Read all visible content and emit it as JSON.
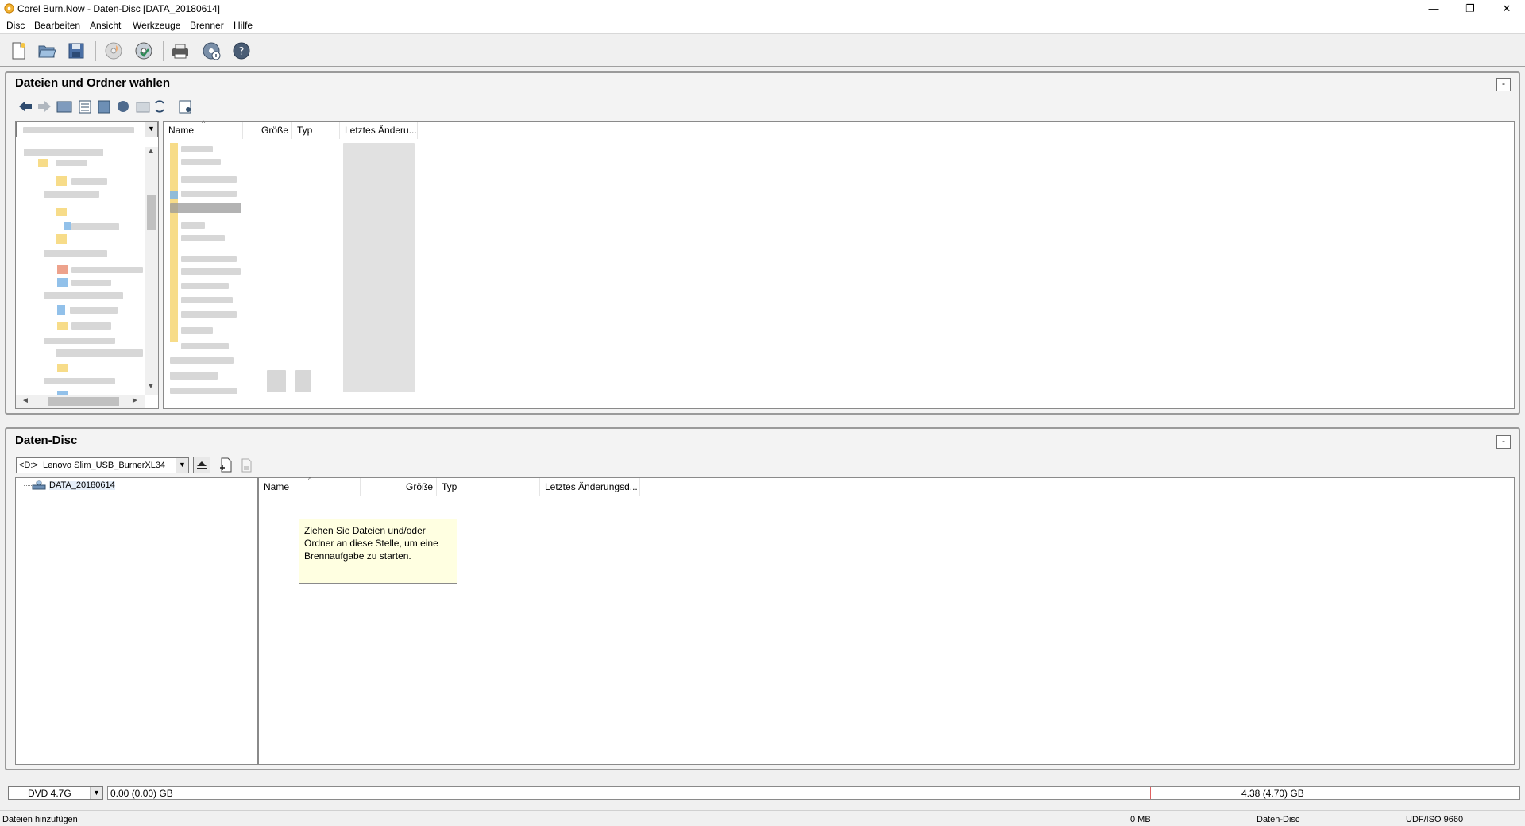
{
  "window": {
    "title": "Corel Burn.Now - Daten-Disc [DATA_20180614]",
    "minimize_glyph": "—",
    "restore_glyph": "❐",
    "close_glyph": "✕"
  },
  "menu": [
    "Disc",
    "Bearbeiten",
    "Ansicht",
    "Werkzeuge",
    "Brenner",
    "Hilfe"
  ],
  "toolbar_icons": [
    "new-project-icon",
    "open-folder-icon",
    "save-icon",
    "burn-disc-icon",
    "disc-copy-icon",
    "printer-icon",
    "disc-info-icon",
    "help-icon"
  ],
  "top_panel": {
    "title": "Dateien und Ordner wählen",
    "collapse_label": "-",
    "columns": [
      "Name",
      "Größe",
      "Typ",
      "Letztes Änderu..."
    ]
  },
  "bottom_panel": {
    "title": "Daten-Disc",
    "collapse_label": "-",
    "drive": "<D:>  Lenovo Slim_USB_BurnerXL34",
    "tree_root": "DATA_20180614",
    "columns": [
      "Name",
      "Größe",
      "Typ",
      "Letztes Änderungsd..."
    ],
    "hint": "Ziehen Sie Dateien und/oder Ordner an diese Stelle, um eine Brennaufgabe zu starten."
  },
  "capacity": {
    "media": "DVD 4.7G",
    "used": "0.00 (0.00) GB",
    "total": "4.38 (4.70) GB",
    "fill_fraction": 0.0
  },
  "status": {
    "message": "Dateien hinzufügen",
    "size": "0 MB",
    "mode": "Daten-Disc",
    "filesystem": "UDF/ISO 9660"
  }
}
